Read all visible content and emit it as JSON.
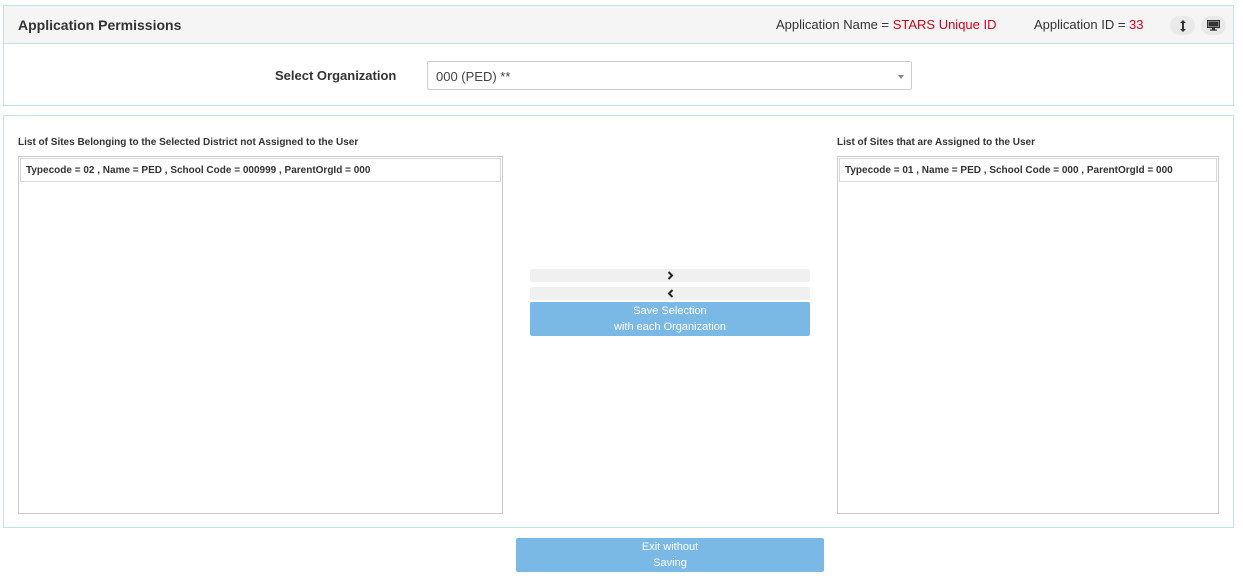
{
  "header": {
    "title": "Application Permissions",
    "app_name_label": "Application Name = ",
    "app_name_value": "STARS Unique ID",
    "app_id_label": "Application ID = ",
    "app_id_value": "33",
    "icons": [
      "resize-vertical-icon",
      "desktop-icon"
    ]
  },
  "organization": {
    "label": "Select Organization",
    "selected": "000 (PED) **"
  },
  "left_list": {
    "title": "List of Sites Belonging to the Selected District not Assigned to the User",
    "items": [
      "Typecode = 02 , Name = PED , School Code = 000999 , ParentOrgId = 000"
    ]
  },
  "right_list": {
    "title": "List of Sites that are Assigned to the User",
    "items": [
      "Typecode = 01 , Name = PED , School Code = 000 , ParentOrgId = 000"
    ]
  },
  "actions": {
    "move_right_icon": "chevron-right-icon",
    "move_left_icon": "chevron-left-icon",
    "save_line1": "Save Selection",
    "save_line2": "with each Organization",
    "exit_line1": "Exit without",
    "exit_line2": "Saving"
  },
  "colors": {
    "accent_red": "#d0021b",
    "button_blue": "#7ab8e6",
    "panel_border": "#bfe3e8"
  }
}
